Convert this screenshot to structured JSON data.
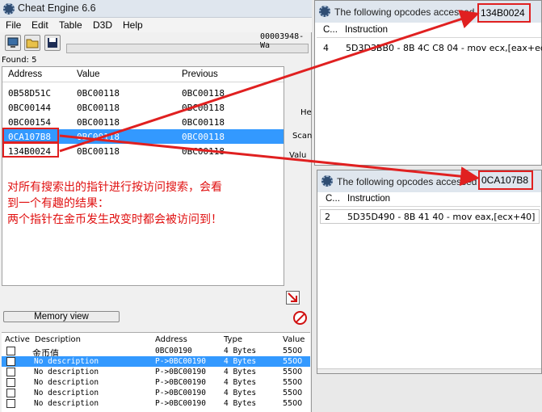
{
  "main_window": {
    "title": "Cheat Engine 6.6",
    "menu": [
      "File",
      "Edit",
      "Table",
      "D3D",
      "Help"
    ],
    "process_label": "00003948-Wa",
    "found_label": "Found: 5",
    "columns": [
      "Address",
      "Value",
      "Previous"
    ],
    "rows": [
      {
        "address": "0B58D51C",
        "value": "0BC00118",
        "previous": "0BC00118"
      },
      {
        "address": "0BC00144",
        "value": "0BC00118",
        "previous": "0BC00118"
      },
      {
        "address": "0BC00154",
        "value": "0BC00118",
        "previous": "0BC00118"
      },
      {
        "address": "0CA107B8",
        "value": "0BC00118",
        "previous": "0BC00118"
      },
      {
        "address": "134B0024",
        "value": "0BC00118",
        "previous": "0BC00118"
      }
    ],
    "side_labels": [
      "He",
      "Scan",
      "Valu"
    ],
    "annotation": [
      "对所有搜索出的指针进行按访问搜索，会看",
      "到一个有趣的结果：",
      "两个指针在金币发生改变时都会被访问到！"
    ],
    "memory_view_label": "Memory view",
    "address_list": {
      "columns": [
        "Active",
        "Description",
        "Address",
        "Type",
        "Value"
      ],
      "rows": [
        {
          "description": "金币值",
          "address": "0BC00190",
          "type": "4 Bytes",
          "value": "5500"
        },
        {
          "description": "No description",
          "address": "P->0BC00190",
          "type": "4 Bytes",
          "value": "5500"
        },
        {
          "description": "No description",
          "address": "P->0BC00190",
          "type": "4 Bytes",
          "value": "5500"
        },
        {
          "description": "No description",
          "address": "P->0BC00190",
          "type": "4 Bytes",
          "value": "5500"
        },
        {
          "description": "No description",
          "address": "P->0BC00190",
          "type": "4 Bytes",
          "value": "5500"
        },
        {
          "description": "No description",
          "address": "P->0BC00190",
          "type": "4 Bytes",
          "value": "5500"
        }
      ]
    }
  },
  "dialog_top": {
    "title_prefix": "The following opcodes accessed",
    "title_address": "134B0024",
    "columns": [
      "C...",
      "Instruction"
    ],
    "row": {
      "count": "4",
      "instruction": "5D3D3BB0 - 8B 4C C8 04  - mov ecx,[eax+ecx"
    }
  },
  "dialog_bottom": {
    "title_prefix": "The following opcodes accessed",
    "title_address": "0CA107B8",
    "columns": [
      "C...",
      "Instruction"
    ],
    "row": {
      "count": "2",
      "instruction": "5D35D490 - 8B 41 40  - mov eax,[ecx+40]"
    }
  },
  "colors": {
    "accent": "#3399ff",
    "highlight": "#e02020"
  }
}
